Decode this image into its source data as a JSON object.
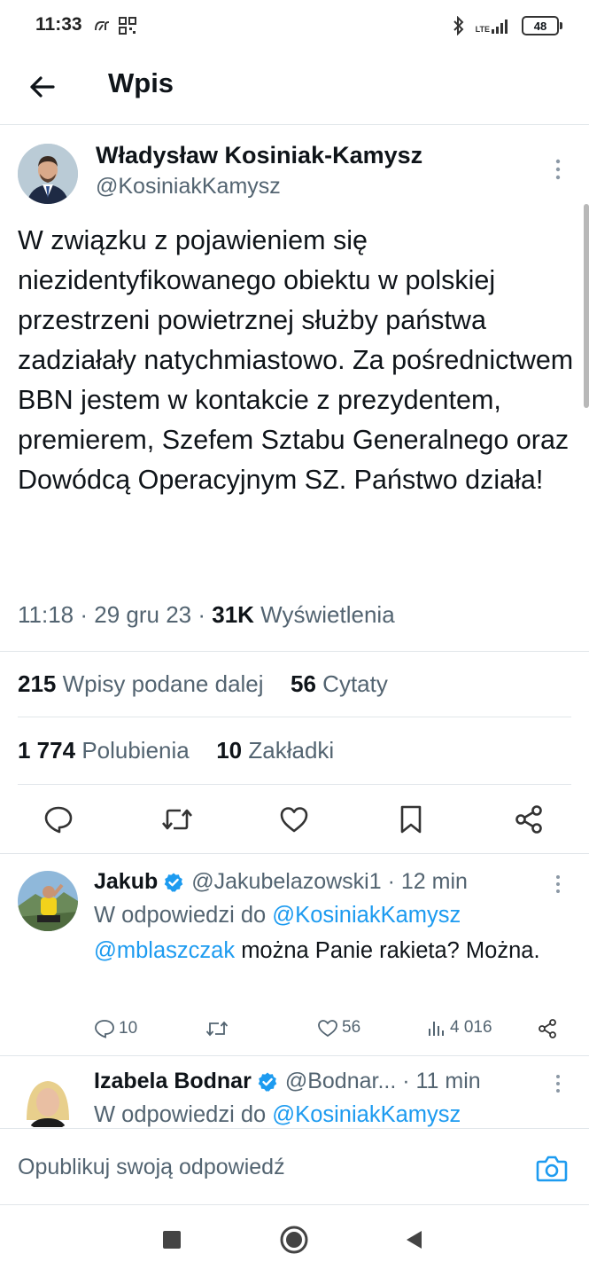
{
  "status_bar": {
    "time": "11:33",
    "network": "LTE",
    "battery": "48"
  },
  "header": {
    "title": "Wpis"
  },
  "tweet": {
    "author_name": "Władysław Kosiniak-Kamysz",
    "author_handle": "@KosiniakKamysz",
    "text": "W związku z pojawieniem się niezidentyfikowanego obiektu w polskiej przestrzeni powietrznej służby państwa zadziałały natychmiastowo. Za pośrednictwem BBN jestem w kontakcie z prezydentem, premierem, Szefem Sztabu Generalnego oraz Dowódcą Operacyjnym SZ. Państwo działa!",
    "time": "11:18",
    "date": "29 gru 23",
    "views_count": "31K",
    "views_label": "Wyświetlenia",
    "retweets_count": "215",
    "retweets_label": "Wpisy podane dalej",
    "quotes_count": "56",
    "quotes_label": "Cytaty",
    "likes_count": "1 774",
    "likes_label": "Polubienia",
    "bookmarks_count": "10",
    "bookmarks_label": "Zakładki"
  },
  "replies": [
    {
      "name": "Jakub",
      "handle": "@Jakubelazowski1",
      "time": "12 min",
      "reply_prefix": "W odpowiedzi do",
      "reply_to": "@KosiniakKamysz",
      "mention": "@mblaszczak",
      "text": "można Panie rakieta? Można.",
      "comments": "10",
      "likes": "56",
      "views": "4 016"
    },
    {
      "name": "Izabela Bodnar",
      "handle": "@Bodnar...",
      "time": "11 min",
      "reply_prefix": "W odpowiedzi do",
      "reply_to": "@KosiniakKamysz"
    }
  ],
  "composer": {
    "placeholder": "Opublikuj swoją odpowiedź"
  },
  "colors": {
    "accent": "#1d9bf0",
    "text": "#0f1419",
    "muted": "#536471",
    "divider": "#e1e6ea"
  }
}
